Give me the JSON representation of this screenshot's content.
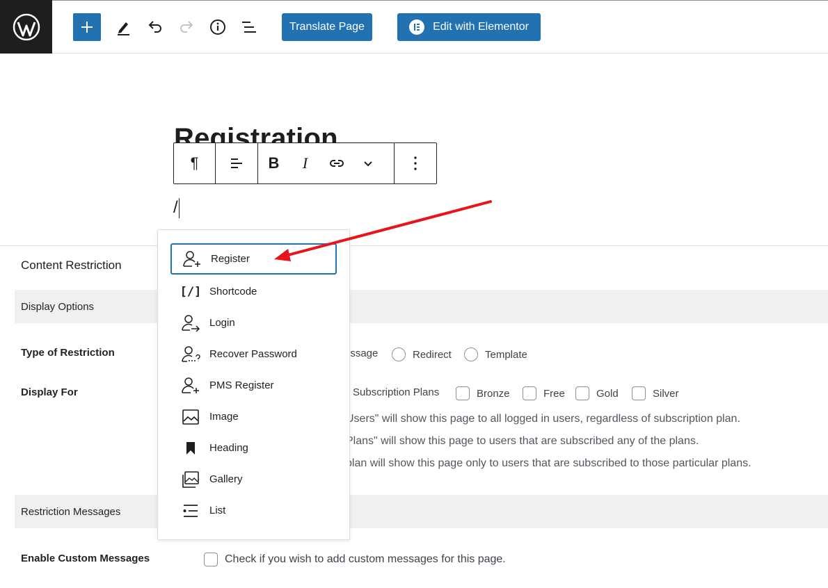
{
  "topbar": {
    "translate_label": "Translate Page",
    "elementor_label": "Edit with Elementor",
    "elementor_badge": "E"
  },
  "editor": {
    "title": "Registration",
    "block_text": "/",
    "toolbar_glyphs": {
      "paragraph": "¶",
      "bold": "B",
      "italic": "I"
    }
  },
  "inserter": {
    "items": [
      {
        "label": "Register",
        "icon": "user-plus-icon",
        "glyph": "",
        "selected": true
      },
      {
        "label": "Shortcode",
        "icon": "shortcode-icon",
        "glyph": "[/]"
      },
      {
        "label": "Login",
        "icon": "user-login-icon",
        "glyph": ""
      },
      {
        "label": "Recover Password",
        "icon": "user-recover-icon",
        "glyph": ""
      },
      {
        "label": "PMS Register",
        "icon": "user-plus-icon",
        "glyph": ""
      },
      {
        "label": "Image",
        "icon": "image-icon",
        "glyph": ""
      },
      {
        "label": "Heading",
        "icon": "bookmark-icon",
        "glyph": ""
      },
      {
        "label": "Gallery",
        "icon": "gallery-icon",
        "glyph": ""
      },
      {
        "label": "List",
        "icon": "list-icon",
        "glyph": ""
      }
    ]
  },
  "meta": {
    "title": "Content Restriction",
    "display_options": "Display Options",
    "type_label": "Type of Restriction",
    "type_options": [
      "essage",
      "Redirect",
      "Template"
    ],
    "display_for_label": "Display For",
    "display_for_options": [
      "Subscription Plans",
      "Bronze",
      "Free",
      "Gold",
      "Silver"
    ],
    "descriptions": [
      "Users\" will show this page to all logged in users, regardless of subscription plan.",
      "Plans\" will show this page to users that are subscribed any of the plans.",
      "plan will show this page only to users that are subscribed to those particular plans."
    ],
    "restriction_messages": "Restriction Messages",
    "custom_messages_label": "Enable Custom Messages",
    "custom_messages_text": "Check if you wish to add custom messages for this page."
  },
  "colors": {
    "accent": "#2271b1",
    "arrow": "#e8131b",
    "dark": "#1e1e1e"
  }
}
